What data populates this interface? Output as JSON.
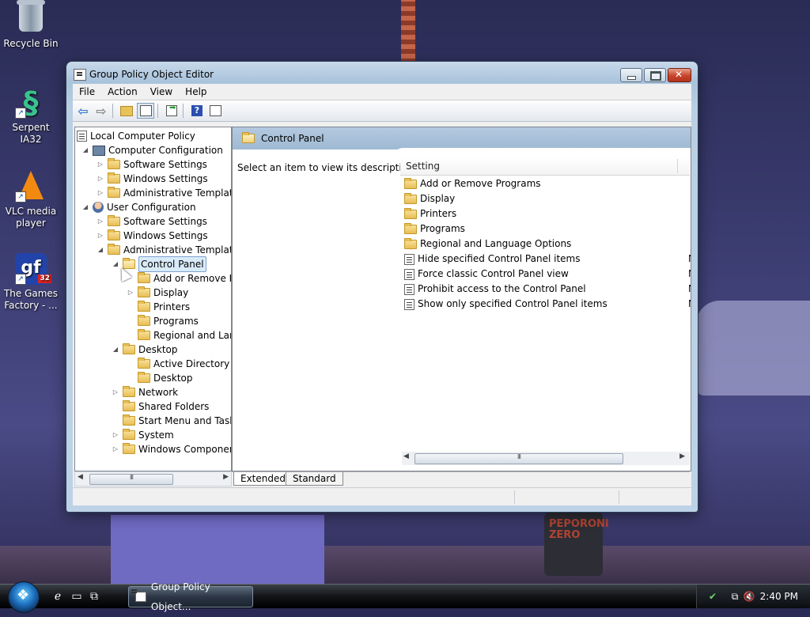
{
  "desktop": {
    "icons": [
      {
        "label": "Recycle Bin"
      },
      {
        "label": "Serpent IA32"
      },
      {
        "label": "VLC media player"
      },
      {
        "label": "The Games Factory - ..."
      }
    ],
    "wall_can_text": "PEPORONI ZERO"
  },
  "window": {
    "title": "Group Policy Object Editor",
    "menu": [
      "File",
      "Action",
      "View",
      "Help"
    ],
    "tree": [
      {
        "label": "Local Computer Policy",
        "level": 0,
        "expander": "",
        "icon": "policy-icon"
      },
      {
        "label": "Computer Configuration",
        "level": 1,
        "expander": "expanded",
        "icon": "computer-icon"
      },
      {
        "label": "Software Settings",
        "level": 2,
        "expander": "collapsed",
        "icon": "folder-icon"
      },
      {
        "label": "Windows Settings",
        "level": 2,
        "expander": "collapsed",
        "icon": "folder-icon"
      },
      {
        "label": "Administrative Template",
        "level": 2,
        "expander": "collapsed",
        "icon": "folder-icon"
      },
      {
        "label": "User Configuration",
        "level": 1,
        "expander": "expanded",
        "icon": "user-icon"
      },
      {
        "label": "Software Settings",
        "level": 2,
        "expander": "collapsed",
        "icon": "folder-icon"
      },
      {
        "label": "Windows Settings",
        "level": 2,
        "expander": "collapsed",
        "icon": "folder-icon"
      },
      {
        "label": "Administrative Template",
        "level": 2,
        "expander": "expanded",
        "icon": "folder-icon"
      },
      {
        "label": "Control Panel",
        "level": 3,
        "expander": "expanded",
        "icon": "folder-open-icon",
        "selected": true
      },
      {
        "label": "Add or Remove P",
        "level": 4,
        "expander": "",
        "icon": "folder-icon"
      },
      {
        "label": "Display",
        "level": 4,
        "expander": "collapsed",
        "icon": "folder-icon"
      },
      {
        "label": "Printers",
        "level": 4,
        "expander": "",
        "icon": "folder-icon"
      },
      {
        "label": "Programs",
        "level": 4,
        "expander": "",
        "icon": "folder-icon"
      },
      {
        "label": "Regional and Lan",
        "level": 4,
        "expander": "",
        "icon": "folder-icon"
      },
      {
        "label": "Desktop",
        "level": 3,
        "expander": "expanded",
        "icon": "folder-icon"
      },
      {
        "label": "Active Directory",
        "level": 4,
        "expander": "",
        "icon": "folder-icon"
      },
      {
        "label": "Desktop",
        "level": 4,
        "expander": "",
        "icon": "folder-icon"
      },
      {
        "label": "Network",
        "level": 3,
        "expander": "collapsed",
        "icon": "folder-icon"
      },
      {
        "label": "Shared Folders",
        "level": 3,
        "expander": "",
        "icon": "folder-icon"
      },
      {
        "label": "Start Menu and Task",
        "level": 3,
        "expander": "",
        "icon": "folder-icon"
      },
      {
        "label": "System",
        "level": 3,
        "expander": "collapsed",
        "icon": "folder-icon"
      },
      {
        "label": "Windows Componer",
        "level": 3,
        "expander": "collapsed",
        "icon": "folder-icon"
      }
    ],
    "right": {
      "header_title": "Control Panel",
      "description": "Select an item to view its description.",
      "column_header": "Setting",
      "items": [
        {
          "label": "Add or Remove Programs",
          "type": "folder",
          "state": ""
        },
        {
          "label": "Display",
          "type": "folder",
          "state": ""
        },
        {
          "label": "Printers",
          "type": "folder",
          "state": ""
        },
        {
          "label": "Programs",
          "type": "folder",
          "state": ""
        },
        {
          "label": "Regional and Language Options",
          "type": "folder",
          "state": ""
        },
        {
          "label": "Hide specified Control Panel items",
          "type": "policy",
          "state": "N"
        },
        {
          "label": "Force classic Control Panel view",
          "type": "policy",
          "state": "N"
        },
        {
          "label": "Prohibit access to the Control Panel",
          "type": "policy",
          "state": "N"
        },
        {
          "label": "Show only specified Control Panel items",
          "type": "policy",
          "state": "N"
        }
      ]
    },
    "tabs": [
      "Extended",
      "Standard"
    ],
    "active_tab": "Extended"
  },
  "taskbar": {
    "task_label": "Group Policy Object...",
    "clock": "2:40 PM"
  }
}
